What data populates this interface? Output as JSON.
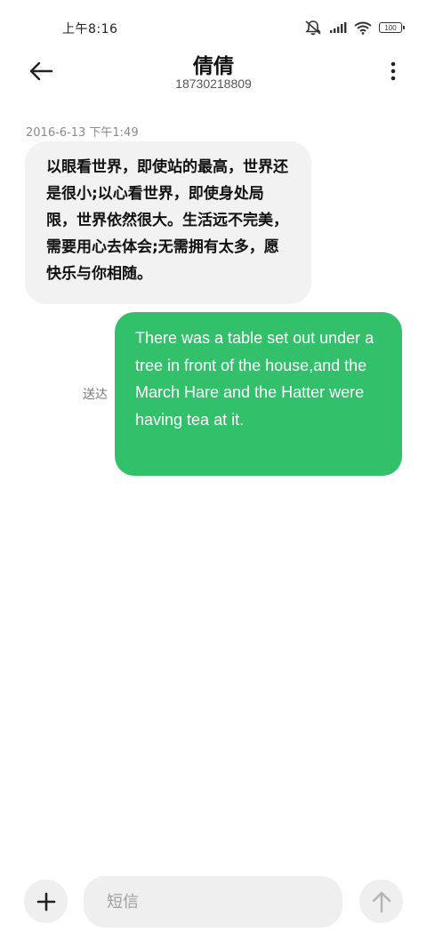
{
  "status_bar": {
    "time": "上午8:16",
    "battery_level": "100",
    "icons": [
      "alarm-muted-icon",
      "signal-icon",
      "wifi-icon",
      "battery-icon"
    ]
  },
  "header": {
    "contact_name": "倩倩",
    "contact_number": "18730218809",
    "icons": [
      "back-arrow-icon",
      "more-vertical-icon"
    ]
  },
  "conversation": {
    "timestamp": "2016-6-13 下午1:49",
    "incoming_message": "以眼看世界，即使站的最高，世界还是很小;以心看世界，即使身处局限，世界依然很大。生活远不完美，需要用心去体会;无需拥有太多，愿快乐与你相随。",
    "outgoing_message": "There was a table set out under a tree in front of the house,and the March Hare and the Hatter were having tea at it.",
    "delivery_status": "送达"
  },
  "composer": {
    "placeholder": "短信",
    "value": "",
    "icons": [
      "plus-icon",
      "send-arrow-icon"
    ]
  },
  "colors": {
    "outgoing_bubble": "#33c06b",
    "incoming_bubble": "#f2f2f2",
    "background": "#ffffff"
  }
}
